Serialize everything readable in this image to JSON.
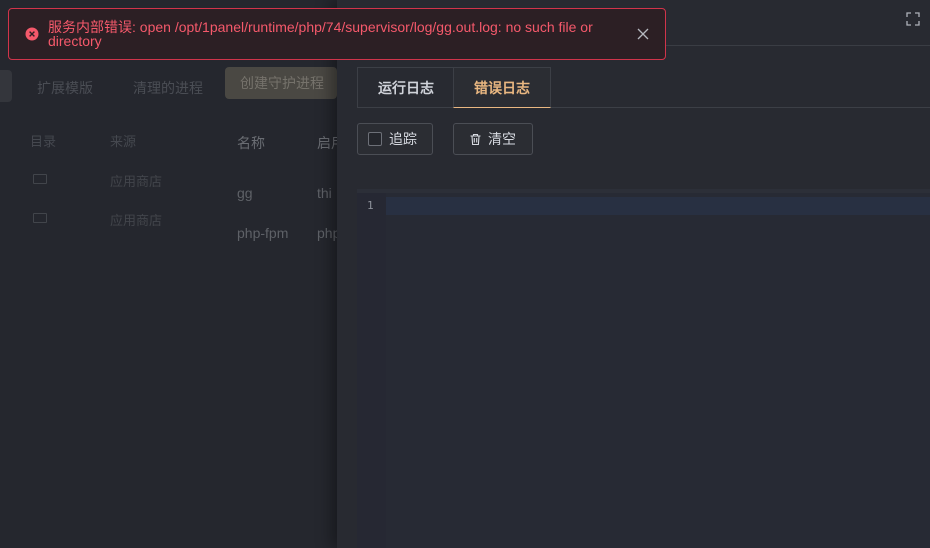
{
  "background": {
    "tabs": [
      "扩展模版",
      "清理的进程"
    ],
    "create_button": "创建守护进程",
    "sub_table": {
      "headers": [
        "目录",
        "来源"
      ],
      "rows": [
        {
          "source": "应用商店"
        },
        {
          "source": "应用商店"
        }
      ]
    },
    "main_table": {
      "headers": [
        "名称",
        "启用"
      ],
      "rows": [
        {
          "name": "gg",
          "value": "thi"
        },
        {
          "name": "php-fpm",
          "value": "php"
        }
      ]
    }
  },
  "drawer": {
    "fullscreen_icon": "fullscreen-icon",
    "tabs": [
      {
        "label": "运行日志",
        "active": false
      },
      {
        "label": "错误日志",
        "active": true
      }
    ],
    "follow_label": "追踪",
    "follow_checked": false,
    "clear_label": "清空",
    "clear_icon": "trash-icon",
    "editor": {
      "lines": [
        ""
      ],
      "line_numbers": [
        "1"
      ]
    }
  },
  "notification": {
    "type": "error",
    "message": "服务内部错误: open /opt/1panel/runtime/php/74/supervisor/log/gg.out.log: no such file or directory",
    "icon": "error-circle-icon",
    "close_icon": "close-icon"
  },
  "colors": {
    "accent": "#e9b781",
    "error": "#f5596b",
    "error_border": "#d1344b"
  }
}
